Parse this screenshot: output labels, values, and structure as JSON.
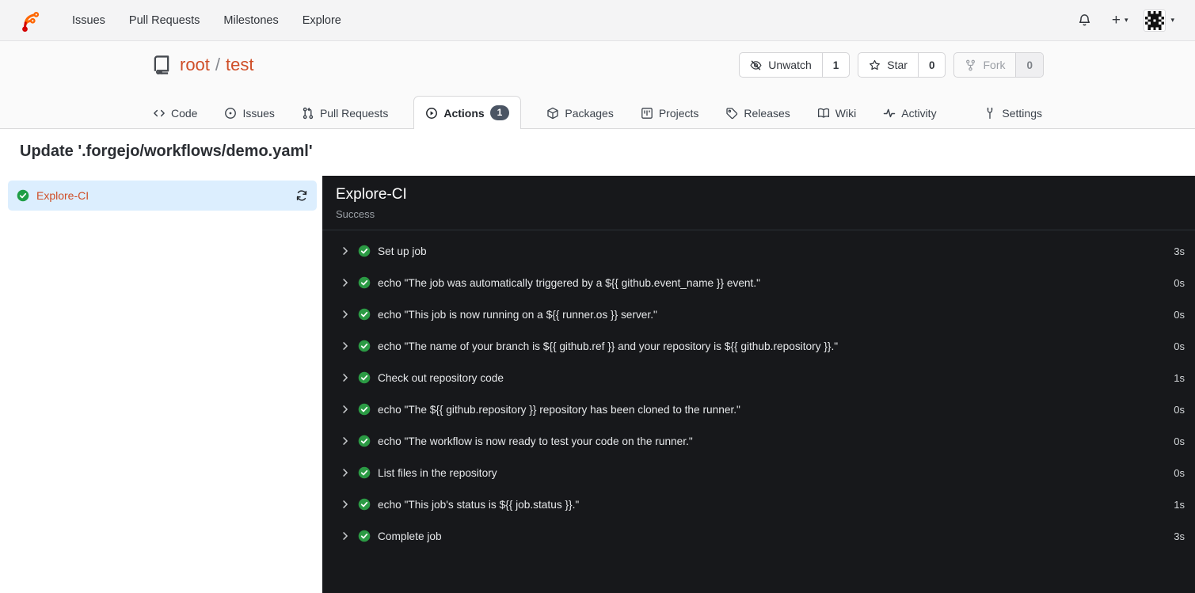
{
  "navbar": {
    "links": [
      {
        "label": "Issues"
      },
      {
        "label": "Pull Requests"
      },
      {
        "label": "Milestones"
      },
      {
        "label": "Explore"
      }
    ]
  },
  "repo": {
    "owner": "root",
    "separator": "/",
    "name": "test",
    "actions": {
      "unwatch": {
        "label": "Unwatch",
        "count": "1"
      },
      "star": {
        "label": "Star",
        "count": "0"
      },
      "fork": {
        "label": "Fork",
        "count": "0"
      }
    },
    "tabs": [
      {
        "label": "Code"
      },
      {
        "label": "Issues"
      },
      {
        "label": "Pull Requests"
      },
      {
        "label": "Actions",
        "badge": "1"
      },
      {
        "label": "Packages"
      },
      {
        "label": "Projects"
      },
      {
        "label": "Releases"
      },
      {
        "label": "Wiki"
      },
      {
        "label": "Activity"
      },
      {
        "label": "Settings"
      }
    ]
  },
  "page": {
    "title": "Update '.forgejo/workflows/demo.yaml'"
  },
  "sidebar": {
    "job": {
      "label": "Explore-CI",
      "status": "success"
    }
  },
  "panel": {
    "title": "Explore-CI",
    "status": "Success",
    "steps": [
      {
        "name": "Set up job",
        "duration": "3s"
      },
      {
        "name": "echo \"The job was automatically triggered by a ${{ github.event_name }} event.\"",
        "duration": "0s"
      },
      {
        "name": "echo \"This job is now running on a ${{ runner.os }} server.\"",
        "duration": "0s"
      },
      {
        "name": "echo \"The name of your branch is ${{ github.ref }} and your repository is ${{ github.repository }}.\"",
        "duration": "0s"
      },
      {
        "name": "Check out repository code",
        "duration": "1s"
      },
      {
        "name": "echo \"The ${{ github.repository }} repository has been cloned to the runner.\"",
        "duration": "0s"
      },
      {
        "name": "echo \"The workflow is now ready to test your code on the runner.\"",
        "duration": "0s"
      },
      {
        "name": "List files in the repository",
        "duration": "0s"
      },
      {
        "name": "echo \"This job's status is ${{ job.status }}.\"",
        "duration": "1s"
      },
      {
        "name": "Complete job",
        "duration": "3s"
      }
    ]
  },
  "colors": {
    "primary_link": "#cf4e27",
    "logo_orange": "#ff6600",
    "logo_red": "#d40000",
    "success_green": "#2b9a44",
    "panel_background": "#17181b",
    "sidebar_selected_background": "#dceefe",
    "tab_badge_background": "#4b5564"
  }
}
